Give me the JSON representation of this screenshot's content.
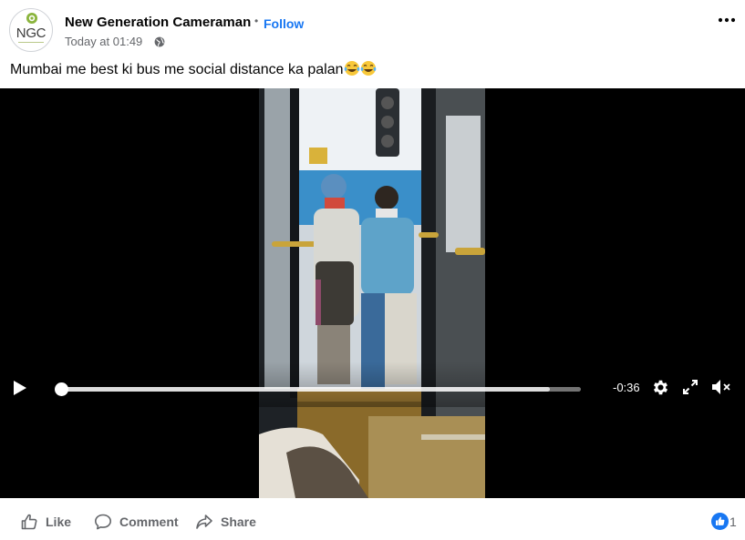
{
  "post": {
    "page_name": "New Generation Cameraman",
    "follow_label": "Follow",
    "timestamp": "Today at 01:49",
    "text": "Mumbai me best ki bus me social distance ka palan",
    "avatar_text": "NGC"
  },
  "video": {
    "time_remaining": "-0:36",
    "progress_fraction": 0.01,
    "buffered_fraction": 0.94
  },
  "actions": {
    "like_label": "Like",
    "comment_label": "Comment",
    "share_label": "Share",
    "reaction_count": "1"
  },
  "icons": {
    "privacy": "globe-icon",
    "menu": "more-horizontal-icon",
    "play": "play-icon",
    "settings": "gear-icon",
    "fullscreen": "fullscreen-icon",
    "volume": "mute-icon",
    "reaction": "like-reaction-icon",
    "emoji": "tears-of-joy-emoji"
  },
  "colors": {
    "link": "#1877f2",
    "secondary_text": "#65676b",
    "video_bg": "#000000"
  }
}
